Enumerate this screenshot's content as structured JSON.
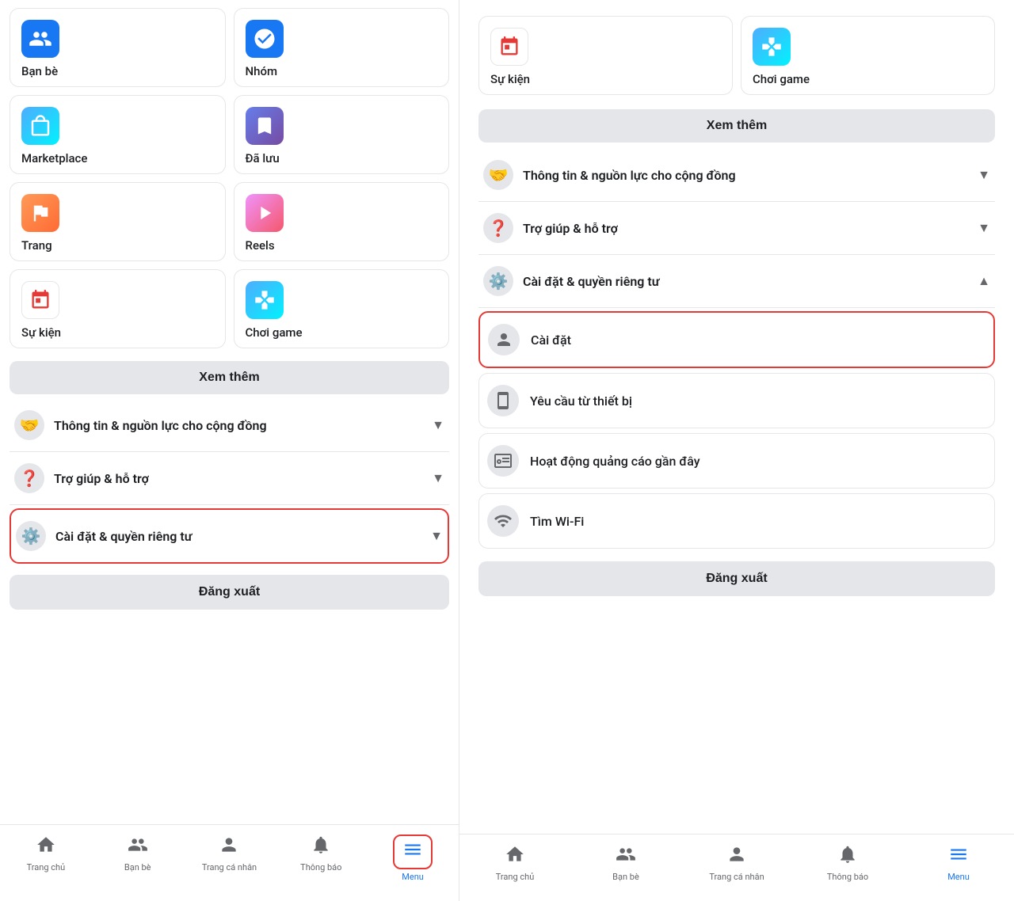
{
  "left_panel": {
    "grid_items": [
      {
        "id": "ban-be",
        "label": "Bạn bè",
        "icon": "👥",
        "icon_style": "background:#1877f2;border-radius:10px;"
      },
      {
        "id": "nhom",
        "label": "Nhóm",
        "icon": "👥",
        "icon_style": "background:#1877f2;border-radius:10px;"
      },
      {
        "id": "marketplace",
        "label": "Marketplace",
        "icon": "🏪",
        "icon_style": "background:linear-gradient(135deg,#4facfe,#00f2fe);border-radius:10px;"
      },
      {
        "id": "da-luu",
        "label": "Đã lưu",
        "icon": "🔖",
        "icon_style": "background:linear-gradient(135deg,#667eea,#764ba2);border-radius:10px;"
      },
      {
        "id": "trang",
        "label": "Trang",
        "icon": "🚩",
        "icon_style": "background:linear-gradient(135deg,#ff9a56,#ff6b35);border-radius:10px;"
      },
      {
        "id": "reels",
        "label": "Reels",
        "icon": "▶️",
        "icon_style": "background:linear-gradient(135deg,#f093fb,#f5576c);border-radius:10px;"
      },
      {
        "id": "su-kien",
        "label": "Sự kiện",
        "icon": "📅",
        "icon_style": "background:#fff;border:1px solid #e4e6ea;border-radius:10px;"
      },
      {
        "id": "choi-game",
        "label": "Chơi game",
        "icon": "🕹️",
        "icon_style": "background:linear-gradient(135deg,#4facfe,#00f2fe);border-radius:10px;"
      }
    ],
    "see_more_label": "Xem thêm",
    "menu_sections": [
      {
        "id": "thong-tin",
        "icon": "🤝",
        "label": "Thông tin & nguồn lực cho cộng đồng",
        "chevron": "▼"
      },
      {
        "id": "tro-giup",
        "icon": "❓",
        "label": "Trợ giúp & hỗ trợ",
        "chevron": "▼"
      },
      {
        "id": "cai-dat",
        "icon": "⚙️",
        "label": "Cài đặt & quyền riêng tư",
        "chevron": "▼",
        "highlighted": true
      }
    ],
    "logout_label": "Đăng xuất",
    "bottom_nav": [
      {
        "id": "trang-chu",
        "icon": "🏠",
        "label": "Trang chủ",
        "active": false
      },
      {
        "id": "ban-be-nav",
        "icon": "👥",
        "label": "Bạn bè",
        "active": false
      },
      {
        "id": "trang-ca-nhan",
        "icon": "👤",
        "label": "Trang cá nhân",
        "active": false
      },
      {
        "id": "thong-bao",
        "icon": "🔔",
        "label": "Thông báo",
        "active": false
      },
      {
        "id": "menu-nav",
        "icon": "☰",
        "label": "Menu",
        "active": true,
        "highlighted": true
      }
    ]
  },
  "right_panel": {
    "partial_top": [
      {
        "id": "su-kien-r",
        "label": "Sự kiện"
      },
      {
        "id": "choi-game-r",
        "label": "Chơi game"
      }
    ],
    "see_more_label": "Xem thêm",
    "menu_sections": [
      {
        "id": "thong-tin-r",
        "icon": "🤝",
        "label": "Thông tin & nguồn lực cho cộng đồng",
        "chevron": "▼"
      },
      {
        "id": "tro-giup-r",
        "icon": "❓",
        "label": "Trợ giúp & hỗ trợ",
        "chevron": "▼"
      },
      {
        "id": "cai-dat-r",
        "icon": "⚙️",
        "label": "Cài đặt & quyền riêng tư",
        "chevron": "▲",
        "expanded": true
      }
    ],
    "sub_items": [
      {
        "id": "cai-dat-sub",
        "icon": "👤",
        "label": "Cài đặt",
        "highlighted": true
      },
      {
        "id": "yeu-cau",
        "icon": "📱",
        "label": "Yêu cầu từ thiết bị"
      },
      {
        "id": "hoat-dong",
        "icon": "🖼️",
        "label": "Hoạt động quảng cáo gần đây"
      },
      {
        "id": "tim-wifi",
        "icon": "📶",
        "label": "Tìm Wi-Fi"
      }
    ],
    "logout_label": "Đăng xuất",
    "bottom_nav": [
      {
        "id": "trang-chu-r",
        "icon": "🏠",
        "label": "Trang chủ",
        "active": false
      },
      {
        "id": "ban-be-r",
        "icon": "👥",
        "label": "Bạn bè",
        "active": false
      },
      {
        "id": "trang-ca-nhan-r",
        "icon": "👤",
        "label": "Trang cá nhân",
        "active": false
      },
      {
        "id": "thong-bao-r",
        "icon": "🔔",
        "label": "Thông báo",
        "active": false
      },
      {
        "id": "menu-r",
        "icon": "☰",
        "label": "Menu",
        "active": true
      }
    ]
  }
}
